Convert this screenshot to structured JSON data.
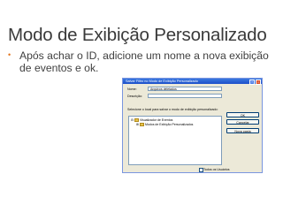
{
  "slide": {
    "title": "Modo de Exibição Personalizado",
    "bullet": "Após achar o ID, adicione um nome a nova exibição de eventos e ok."
  },
  "dialog": {
    "title": "Salvar Filtro no Modo de Exibição Personalizado",
    "name_label": "Nome:",
    "name_value": "Arquivos deletados",
    "description_label": "Descrição:",
    "location_label": "Selecione o local para salvar o modo de exibição personalizado:",
    "tree": {
      "root": "Visualizador de Eventos",
      "child": "Modos de Exibição Personalizados"
    },
    "ok_label": "OK",
    "cancel_label": "Cancelar",
    "new_folder_label": "Nova pasta",
    "all_users_label": "Todos os Usuários",
    "all_users_checked": false
  },
  "colors": {
    "bullet_accent": "#e2751f",
    "titlebar": "#2a5fd6",
    "dialog_bg": "#ece9d8"
  }
}
